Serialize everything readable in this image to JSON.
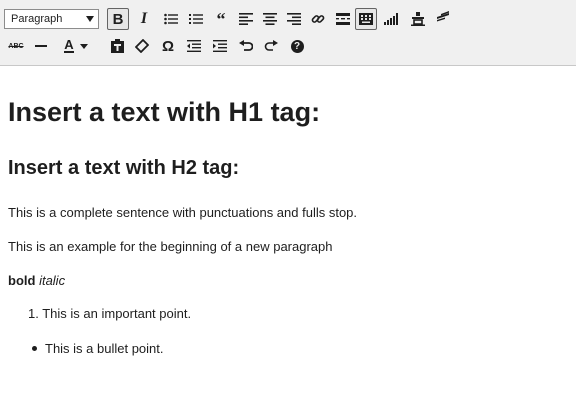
{
  "toolbar": {
    "format_select": {
      "value": "Paragraph"
    },
    "row1_buttons": [
      {
        "name": "bold-button",
        "icon": "bold-icon",
        "glyph": "B",
        "active": true
      },
      {
        "name": "italic-button",
        "icon": "italic-icon",
        "glyph": "I",
        "active": false
      },
      {
        "name": "bullet-list-button",
        "icon": "bullet-list-icon",
        "active": false
      },
      {
        "name": "numbered-list-button",
        "icon": "numbered-list-icon",
        "active": false
      },
      {
        "name": "blockquote-button",
        "icon": "blockquote-icon",
        "active": false
      },
      {
        "name": "align-left-button",
        "icon": "align-left-icon",
        "active": false
      },
      {
        "name": "align-center-button",
        "icon": "align-center-icon",
        "active": false
      },
      {
        "name": "align-right-button",
        "icon": "align-right-icon",
        "active": false
      },
      {
        "name": "link-button",
        "icon": "link-icon",
        "active": false
      },
      {
        "name": "read-more-button",
        "icon": "read-more-icon",
        "active": false
      },
      {
        "name": "toolbar-toggle-button",
        "icon": "keyboard-icon",
        "active": true
      },
      {
        "name": "signal-button",
        "icon": "signal-icon",
        "active": false
      },
      {
        "name": "unlink-button",
        "icon": "unlink-icon",
        "active": false
      },
      {
        "name": "distraction-free-button",
        "icon": "distraction-free-icon",
        "active": false
      }
    ],
    "row2_buttons": [
      {
        "name": "strikethrough-button",
        "icon": "strikethrough-icon",
        "glyph": "ABC"
      },
      {
        "name": "horizontal-line-button",
        "icon": "horizontal-line-icon"
      },
      {
        "name": "text-color-button",
        "icon": "text-color-icon",
        "glyph": "A"
      },
      {
        "name": "paste-as-text-button",
        "icon": "paste-icon"
      },
      {
        "name": "clear-formatting-button",
        "icon": "eraser-icon"
      },
      {
        "name": "special-character-button",
        "icon": "omega-icon",
        "glyph": "Ω"
      },
      {
        "name": "outdent-button",
        "icon": "outdent-icon"
      },
      {
        "name": "indent-button",
        "icon": "indent-icon"
      },
      {
        "name": "undo-button",
        "icon": "undo-icon"
      },
      {
        "name": "redo-button",
        "icon": "redo-icon"
      },
      {
        "name": "help-button",
        "icon": "help-icon",
        "glyph": "?"
      }
    ]
  },
  "content": {
    "h1": "Insert a text with H1 tag:",
    "h2": "Insert a text with H2 tag:",
    "p1": "This is a complete sentence with punctuations and fulls stop.",
    "p2": "This is an example for the beginning of a new paragraph",
    "bold_text": "bold",
    "italic_text": "italic",
    "ordered_item_number": "1.",
    "ordered_item": "This is an important point.",
    "bullet_item": "This is a bullet point."
  },
  "colors": {
    "toolbar_bg": "#f0f0f0",
    "text": "#1e1e1e",
    "active_border": "#646464"
  }
}
